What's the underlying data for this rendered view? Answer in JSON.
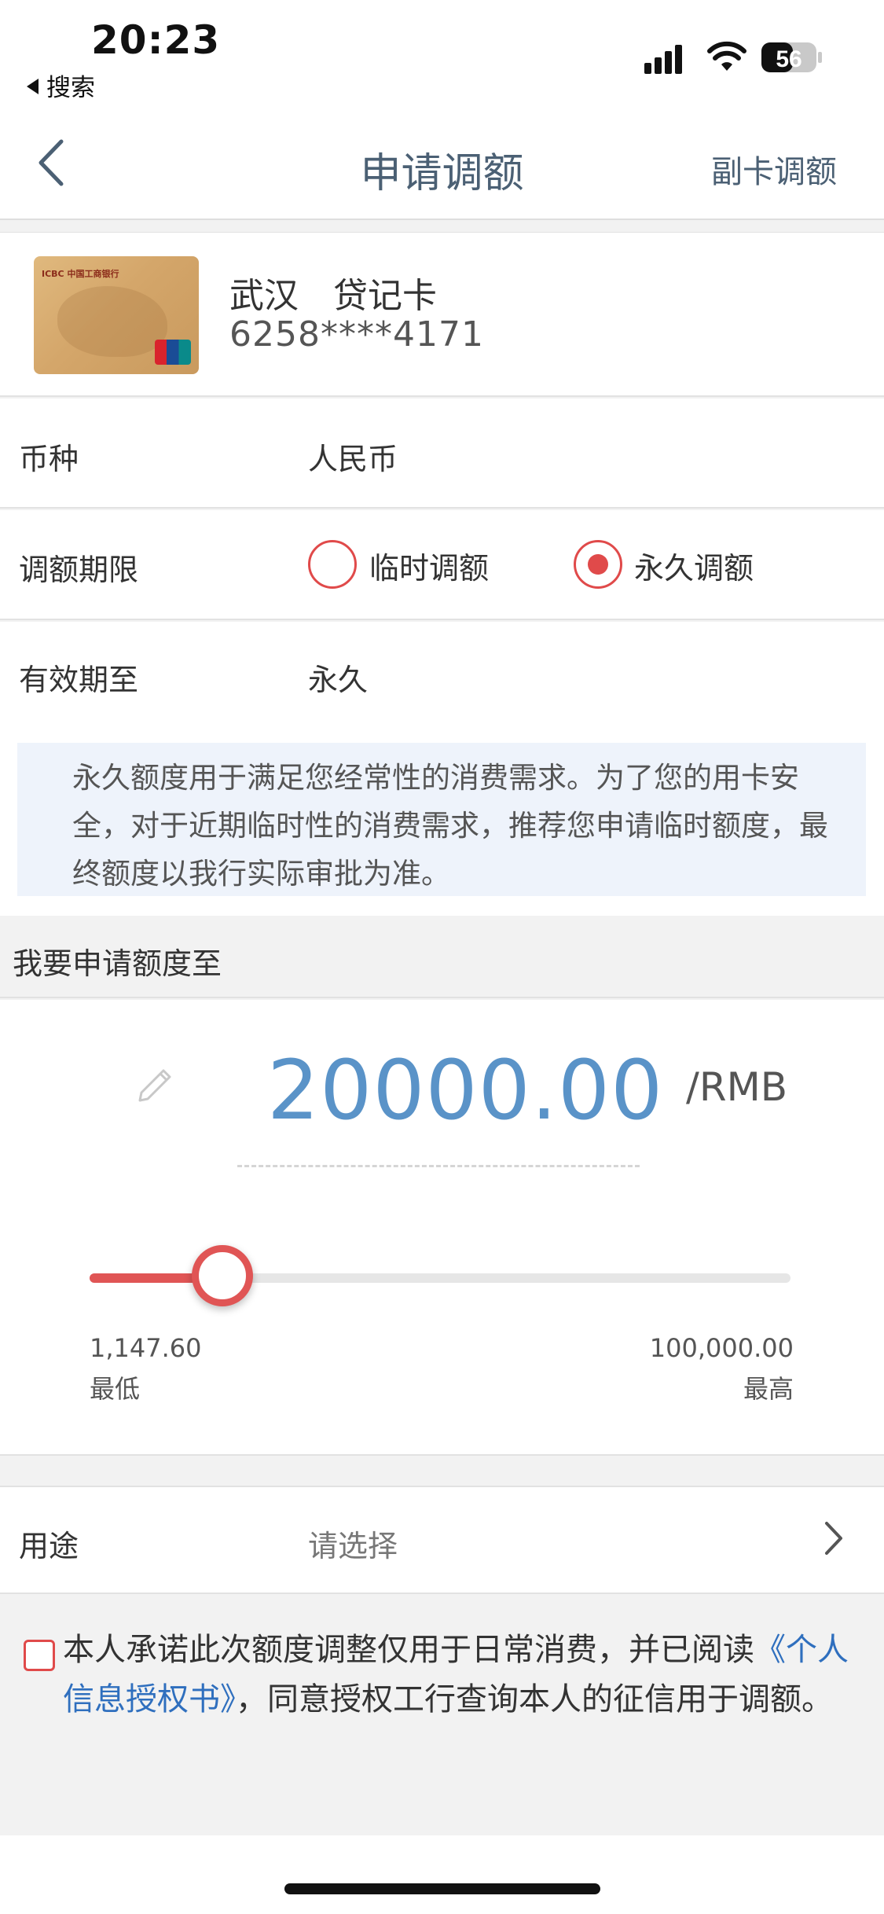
{
  "status_bar": {
    "time": "20:23",
    "back_app": "搜索",
    "battery": "56"
  },
  "nav": {
    "title": "申请调额",
    "right_action": "副卡调额"
  },
  "card": {
    "name": "武汉　贷记卡",
    "number": "6258****4171"
  },
  "currency_row": {
    "label": "币种",
    "value": "人民币"
  },
  "term_row": {
    "label": "调额期限",
    "options": [
      {
        "label": "临时调额",
        "selected": false
      },
      {
        "label": "永久调额",
        "selected": true
      }
    ]
  },
  "valid_row": {
    "label": "有效期至",
    "value": "永久"
  },
  "info": {
    "text": "永久额度用于满足您经常性的消费需求。为了您的用卡安全，对于近期临时性的消费需求，推荐您申请临时额度，最终额度以我行实际审批为准。"
  },
  "amount": {
    "header": "我要申请额度至",
    "value": "20000.00",
    "unit": "/RMB",
    "slider_fraction": 0.19,
    "min_value": "1,147.60",
    "min_label": "最低",
    "max_value": "100,000.00",
    "max_label": "最高"
  },
  "purpose": {
    "label": "用途",
    "placeholder": "请选择"
  },
  "agreement": {
    "checked": false,
    "text_before": "本人承诺此次额度调整仅用于日常消费，并已阅读",
    "link": "《个人信息授权书》",
    "text_after": "，同意授权工行查询本人的征信用于调额。"
  },
  "colors": {
    "accent_red": "#e04a4a",
    "amount_blue": "#5a93c8",
    "link_blue": "#2f6fbe",
    "nav_text": "#4b6074"
  },
  "icons": [
    "back-arrow-icon",
    "signal-icon",
    "wifi-icon",
    "battery-icon",
    "pencil-icon",
    "chevron-right-icon"
  ]
}
